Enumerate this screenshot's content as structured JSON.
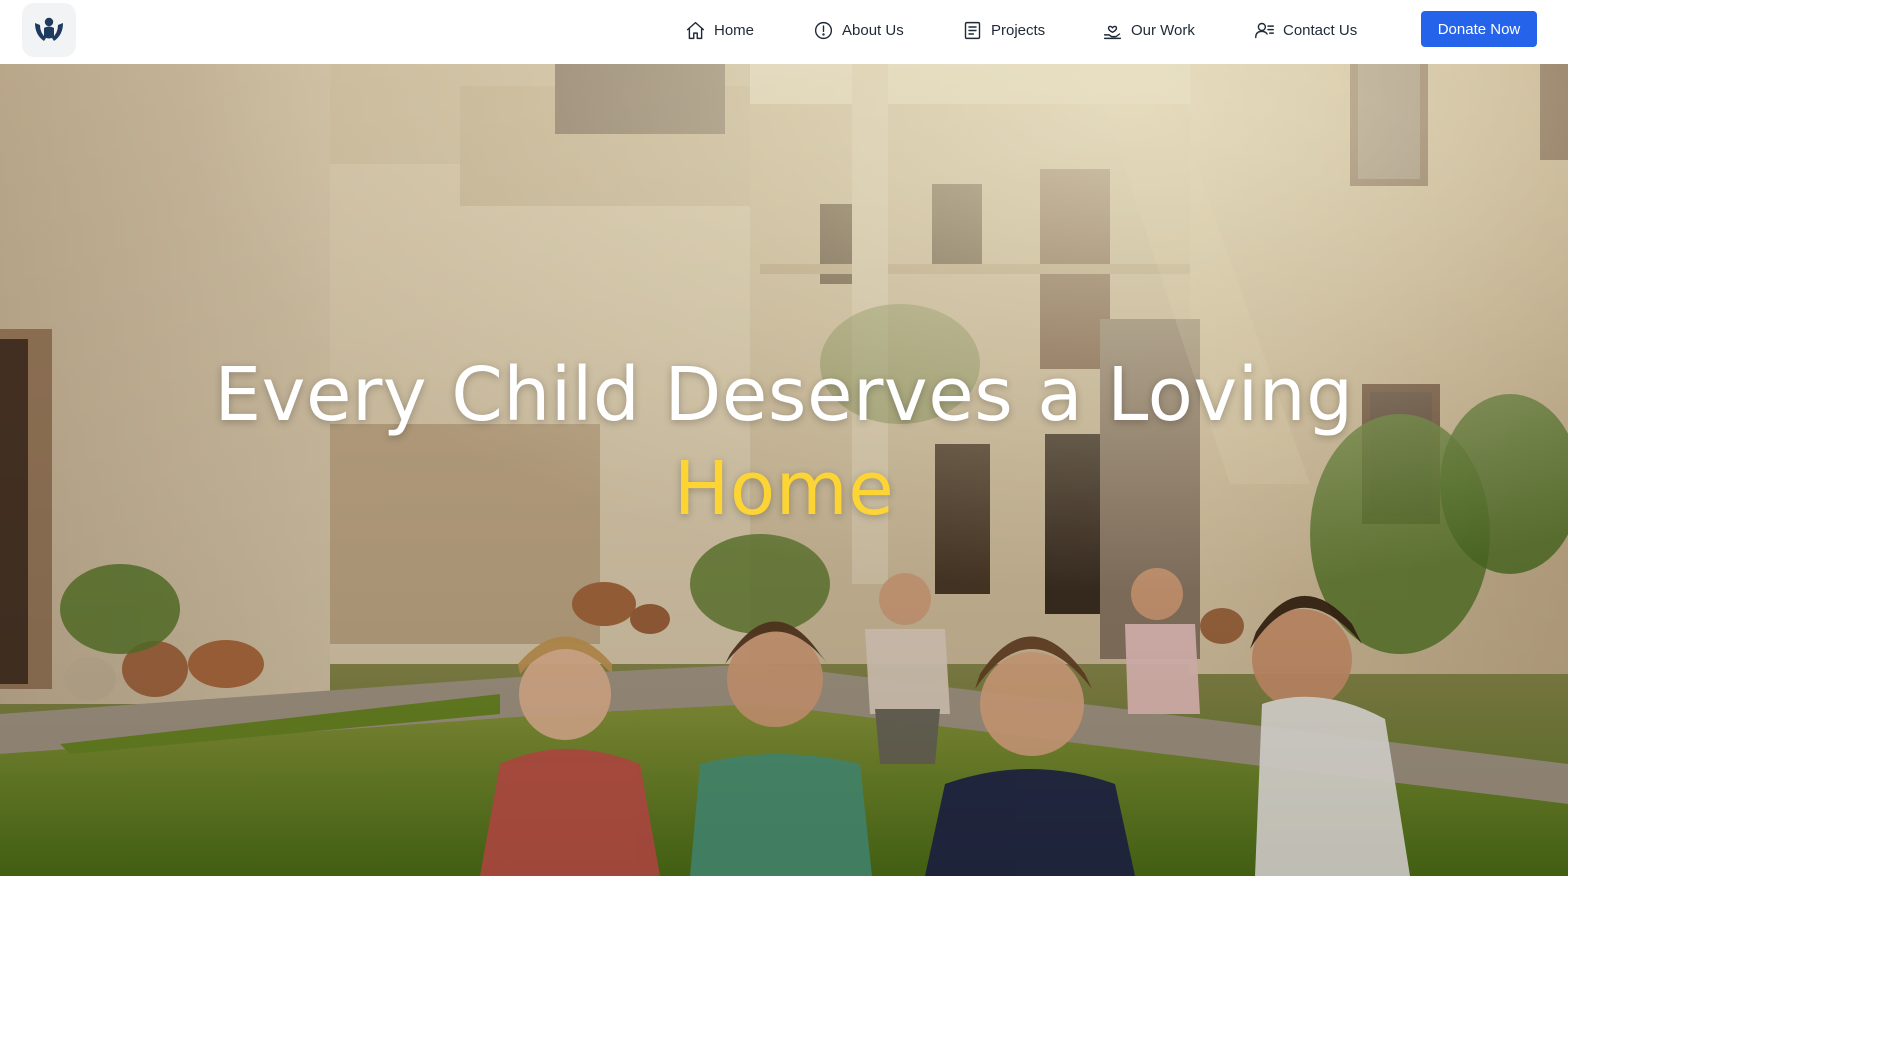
{
  "brand": {
    "logo_icon": "hands-holding-child-icon",
    "accent_color": "#1e3a5f"
  },
  "nav": {
    "items": [
      {
        "label": "Home",
        "icon": "home-icon"
      },
      {
        "label": "About Us",
        "icon": "info-circle-icon"
      },
      {
        "label": "Projects",
        "icon": "document-list-icon"
      },
      {
        "label": "Our Work",
        "icon": "hand-heart-icon"
      },
      {
        "label": "Contact Us",
        "icon": "user-list-icon"
      }
    ],
    "donate_label": "Donate Now",
    "donate_color": "#2563eb"
  },
  "hero": {
    "headline": "Every Child Deserves a Loving",
    "headline_accent": "Home",
    "accent_color": "#fcd535",
    "background": "sunlit courtyard photo with children playing on grass"
  }
}
